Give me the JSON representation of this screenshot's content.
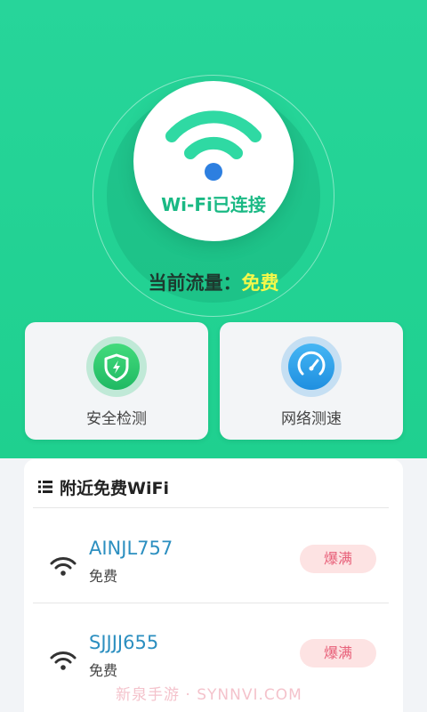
{
  "hero": {
    "status_label": "Wi-Fi已连接",
    "traffic_label": "当前流量：",
    "traffic_value": "免费",
    "accent_color": "#27d59a"
  },
  "actions": [
    {
      "label": "安全检测",
      "icon": "shield-lightning-icon"
    },
    {
      "label": "网络测速",
      "icon": "speedometer-icon"
    }
  ],
  "nearby": {
    "title": "附近免费WiFi",
    "networks": [
      {
        "ssid": "AINJL757",
        "type": "免费",
        "status": "爆满"
      },
      {
        "ssid": "SJJJJ655",
        "type": "免费",
        "status": "爆满"
      }
    ]
  },
  "watermark": "新泉手游 · SYNNVI.COM"
}
